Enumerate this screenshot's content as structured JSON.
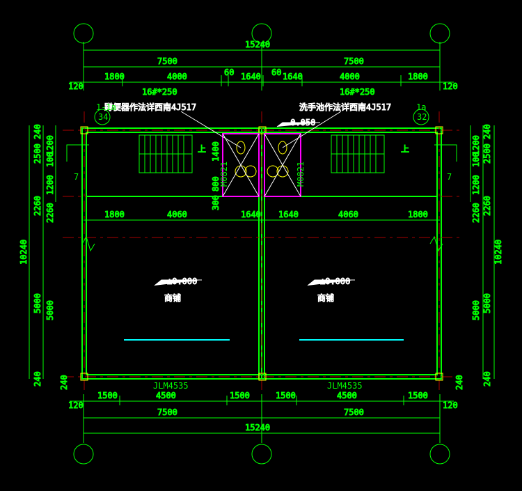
{
  "dims": {
    "total_w": "15240",
    "bay": "7500",
    "col": "120",
    "t1": "1800",
    "t2": "4000",
    "t3": "1640",
    "t4": "60",
    "lintel": "16#*250",
    "b1": "1500",
    "b2": "4500",
    "vTotal": "10240",
    "v240": "240",
    "v1200": "1200",
    "v100": "100",
    "v2500": "2500",
    "v2260": "2260",
    "v5000": "5000",
    "i800": "800",
    "i1400": "1400",
    "i300": "300",
    "mid1": "4060",
    "m0821": "M0821",
    "elev0": "±0.000",
    "elevN": "-0.050",
    "shop": "商铺",
    "up": "上",
    "jlm": "JLM4535",
    "note1": "蹲便器作法详西南4J517",
    "note2": "洗手池作法详西南4J517",
    "grid7": "7",
    "g34": "34",
    "g32": "32",
    "g1a": "1a",
    "g1la": "1-1a"
  }
}
